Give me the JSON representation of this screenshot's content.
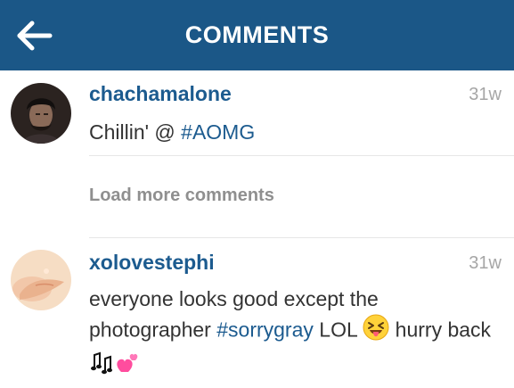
{
  "header": {
    "title": "COMMENTS"
  },
  "comments": [
    {
      "username": "chachamalone",
      "time": "31w",
      "text_plain": "Chillin' @ ",
      "hashtag": "#AOMG"
    },
    {
      "username": "xolovestephi",
      "time": "31w",
      "text_plain_1": "everyone looks good except the photographer ",
      "hashtag": "#sorrygray",
      "text_plain_2": " LOL ",
      "text_plain_3": " hurry back "
    }
  ],
  "load_more": {
    "label": "Load more comments"
  },
  "icons": {
    "back": "back-arrow-icon",
    "emoji_1": "squinting-face-with-tongue-icon",
    "emoji_2": "musical-notes-icon",
    "emoji_3": "two-hearts-icon"
  },
  "colors": {
    "header_bg": "#1b5787",
    "username": "#1c5b8f",
    "hashtag": "#1c5b8f",
    "timestamp": "#a6a6a6",
    "load_more": "#8f8f8f"
  }
}
